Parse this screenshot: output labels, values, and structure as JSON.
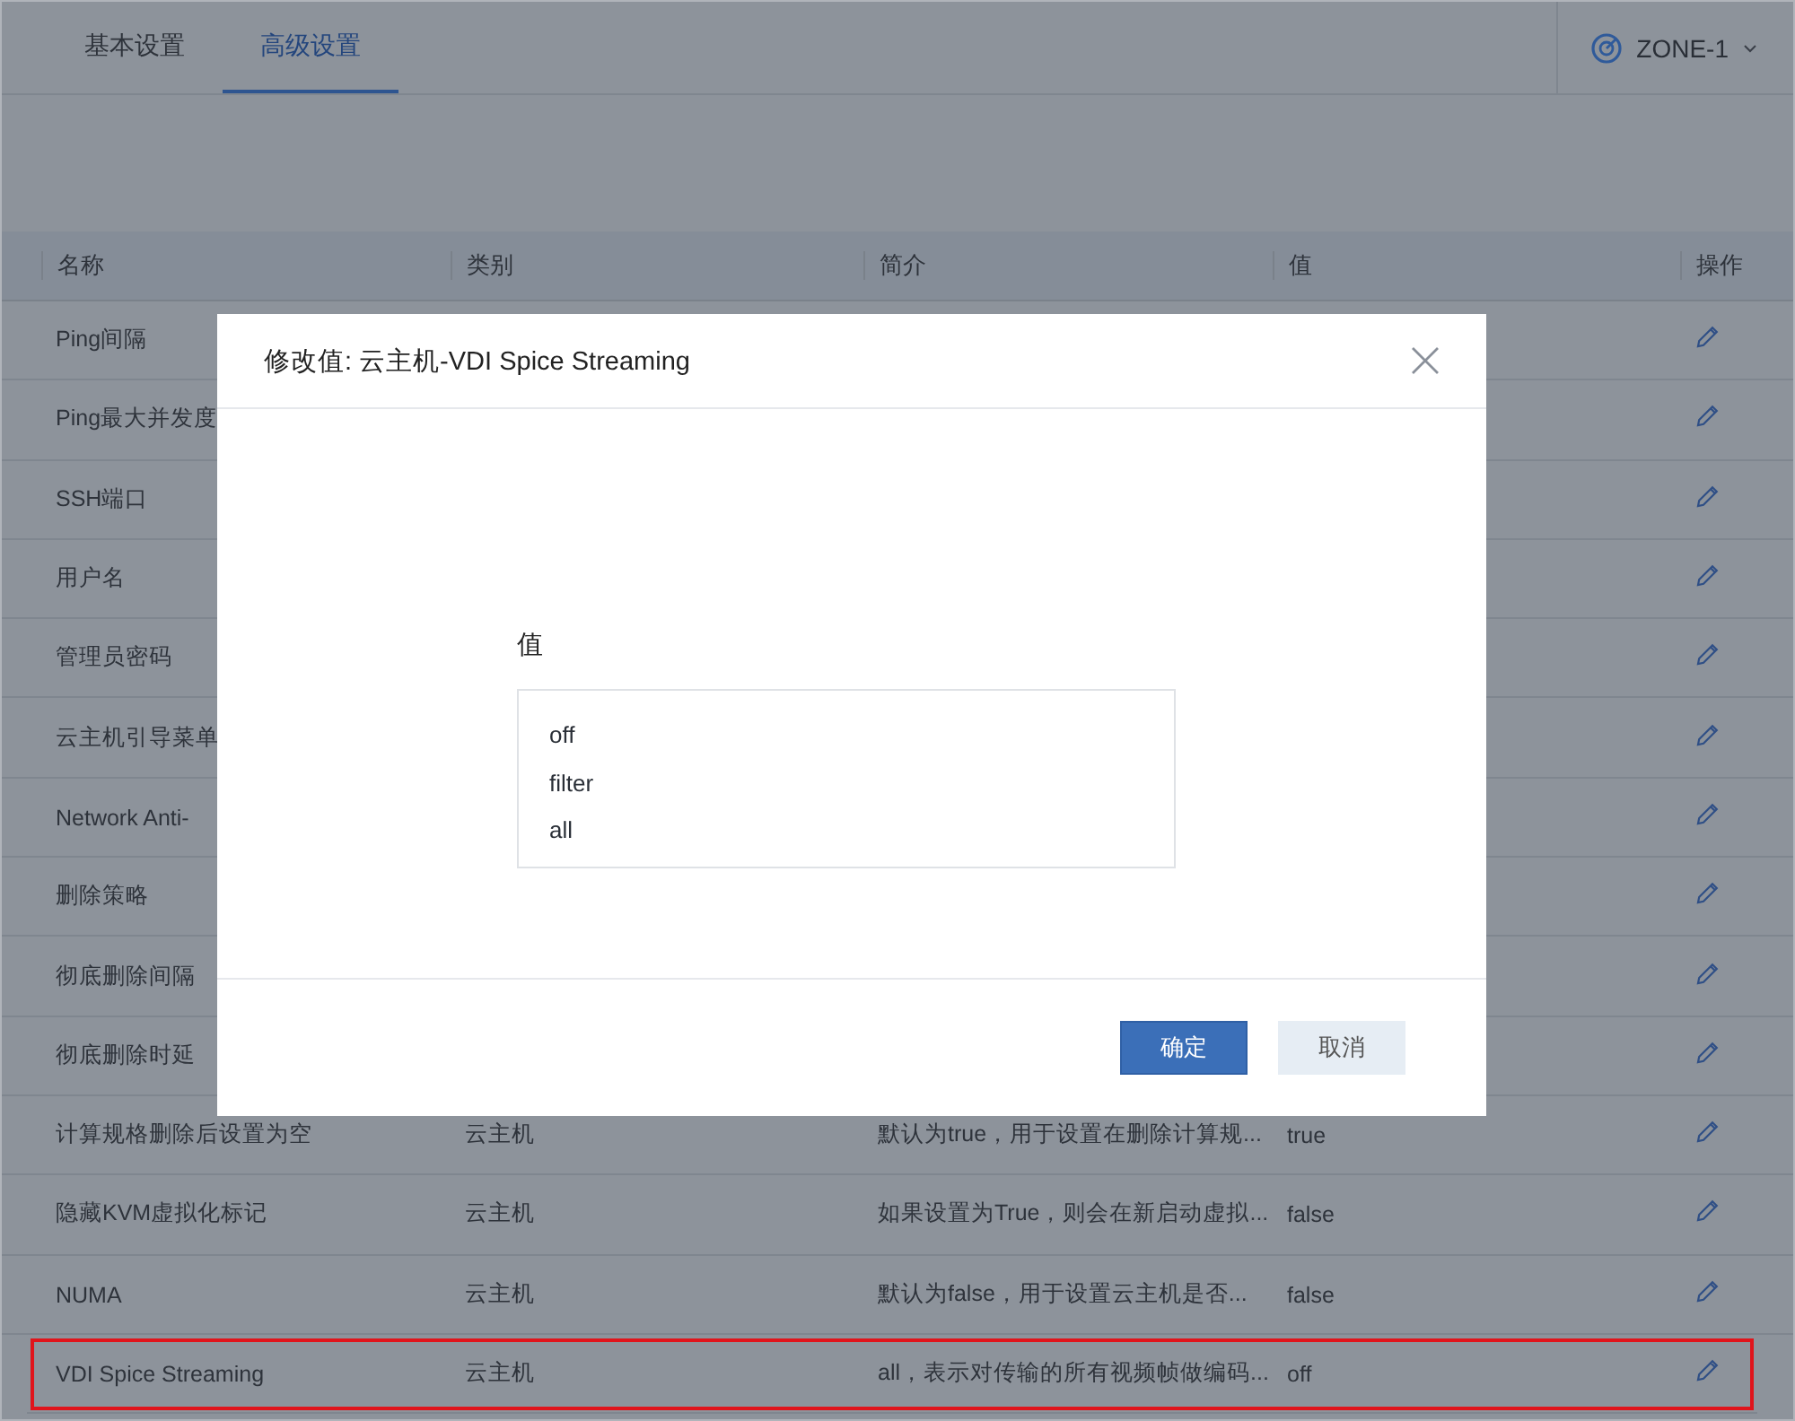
{
  "tabs": [
    {
      "label": "基本设置",
      "selected": false
    },
    {
      "label": "高级设置",
      "selected": true
    }
  ],
  "zone": {
    "label": "ZONE-1"
  },
  "table": {
    "columns": [
      "名称",
      "类别",
      "简介",
      "值",
      "操作"
    ],
    "rows": [
      {
        "name": "Ping间隔",
        "highlighted": false
      },
      {
        "name": "Ping最大并发度",
        "highlighted": false
      },
      {
        "name": "SSH端口",
        "highlighted": false
      },
      {
        "name": "用户名",
        "highlighted": false
      },
      {
        "name": "管理员密码",
        "highlighted": false
      },
      {
        "name": "云主机引导菜单",
        "highlighted": false
      },
      {
        "name": "Network Anti-",
        "highlighted": false
      },
      {
        "name": "删除策略",
        "highlighted": false
      },
      {
        "name": "彻底删除间隔",
        "highlighted": false
      },
      {
        "name": "彻底删除时延",
        "highlighted": false
      },
      {
        "name": "计算规格删除后设置为空",
        "category": "云主机",
        "description": "默认为true，用于设置在删除计算规...",
        "value": "true",
        "highlighted": false
      },
      {
        "name": "隐藏KVM虚拟化标记",
        "category": "云主机",
        "description": "如果设置为True，则会在新启动虚拟...",
        "value": "false",
        "highlighted": false
      },
      {
        "name": "NUMA",
        "category": "云主机",
        "description": "默认为false，用于设置云主机是否...",
        "value": "false",
        "highlighted": false
      },
      {
        "name": "VDI Spice Streaming",
        "category": "云主机",
        "description": "all，表示对传输的所有视频帧做编码...",
        "value": "off",
        "highlighted": true
      }
    ]
  },
  "dialog": {
    "title": "修改值: 云主机-VDI Spice Streaming",
    "field_label": "值",
    "options": [
      {
        "label": "off",
        "selected": false
      },
      {
        "label": "filter",
        "selected": false
      },
      {
        "label": "all",
        "selected": false
      }
    ],
    "buttons": [
      {
        "label": "确定",
        "kind": "primary"
      },
      {
        "label": "取消",
        "kind": "secondary"
      }
    ]
  }
}
